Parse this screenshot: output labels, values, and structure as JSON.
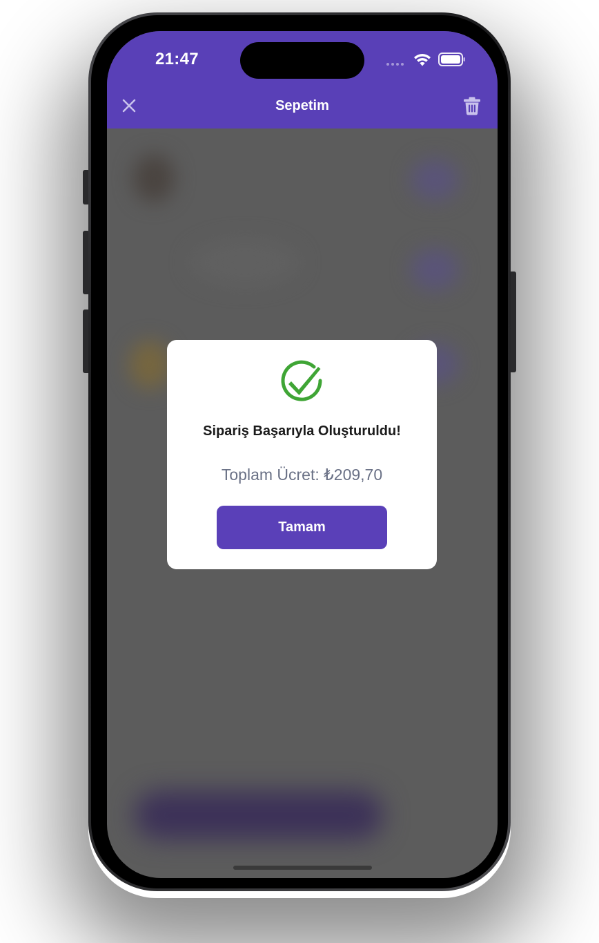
{
  "status_bar": {
    "time": "21:47",
    "icons": [
      "signal-dots-icon",
      "wifi-icon",
      "battery-icon"
    ]
  },
  "header": {
    "title": "Sepetim",
    "left_icon": "close-icon",
    "right_icon": "trash-icon",
    "background_color": "#5940b7"
  },
  "modal": {
    "icon": "check-circle-icon",
    "icon_color": "#3fa535",
    "title": "Sipariş Başarıyla Oluşturuldu!",
    "price_text": "Toplam Ücret: ₺209,70",
    "button_label": "Tamam",
    "button_color": "#5a40b8"
  }
}
